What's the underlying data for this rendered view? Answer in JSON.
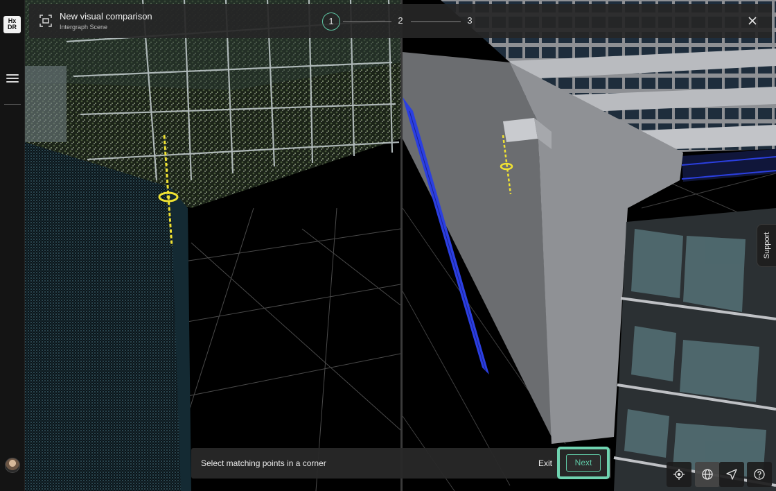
{
  "app": {
    "logo_line1": "Hx",
    "logo_line2": "DR"
  },
  "header": {
    "title": "New visual comparison",
    "subtitle": "Intergraph Scene",
    "steps": [
      "1",
      "2",
      "3"
    ],
    "active_step": "1"
  },
  "support": {
    "label": "Support"
  },
  "bottom_bar": {
    "instruction": "Select matching points in a corner",
    "exit_label": "Exit",
    "next_label": "Next"
  },
  "colors": {
    "accent": "#5fc7a4",
    "highlight": "#6fd3b0",
    "marker": "#f0e232",
    "facade_blue": "#2b3fe0"
  },
  "icons": [
    "compare-frame-icon",
    "close-icon",
    "menu-icon",
    "locate-icon",
    "globe-icon",
    "send-icon",
    "help-icon"
  ]
}
